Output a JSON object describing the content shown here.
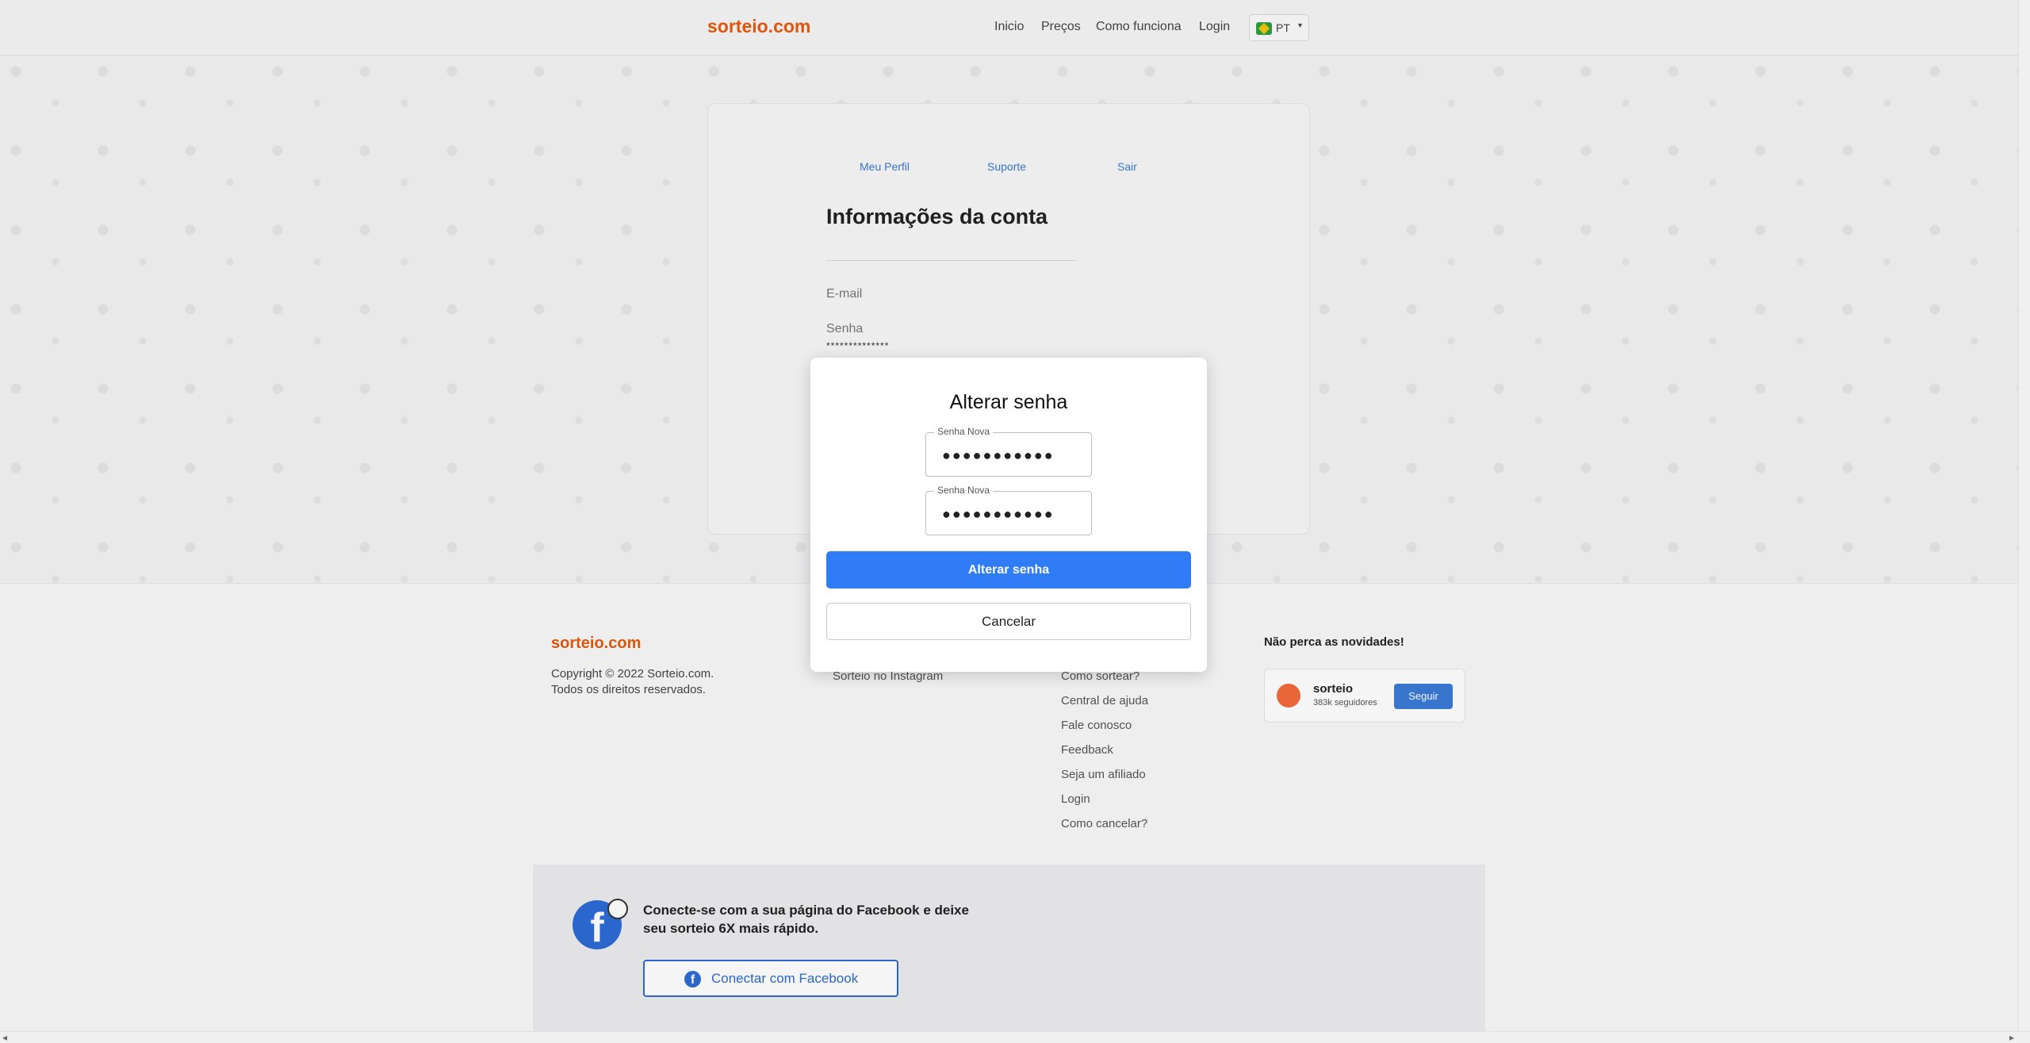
{
  "header": {
    "logo": "sorteio.com",
    "nav": [
      "Inicio",
      "Preços",
      "Como funciona",
      "Login"
    ],
    "language": "PT"
  },
  "account": {
    "tabs": [
      "Meu Perfil",
      "Suporte",
      "Sair"
    ],
    "title": "Informações da conta",
    "email_label": "E-mail",
    "password_label": "Senha",
    "password_value": "**************"
  },
  "modal": {
    "title": "Alterar senha",
    "field1_label": "Senha Nova",
    "field1_value": "●●●●●●●●●●●",
    "field2_label": "Senha Nova",
    "field2_value": "●●●●●●●●●●●",
    "submit_label": "Alterar senha",
    "cancel_label": "Cancelar"
  },
  "footer": {
    "logo": "sorteio.com",
    "copyright": "Copyright © 2022 Sorteio.com.",
    "rights": "Todos os direitos reservados.",
    "mid_link": "Sorteio no Instagram",
    "links": [
      "Como sortear?",
      "Central de ajuda",
      "Fale conosco",
      "Feedback",
      "Seja um afiliado",
      "Login",
      "Como cancelar?"
    ],
    "newsletter_title": "Não perca as novidades!",
    "follow": {
      "name": "sorteio",
      "followers": "383k seguidores",
      "button": "Seguir"
    },
    "facebook": {
      "text": "Conecte-se com a sua página do Facebook e deixe seu sorteio 6X mais rápido.",
      "button": "Conectar com Facebook"
    }
  },
  "colors": {
    "brand": "#e8590c",
    "primary_button": "#2f7cf6",
    "link": "#3a78d8",
    "facebook": "#2d6bd6"
  }
}
